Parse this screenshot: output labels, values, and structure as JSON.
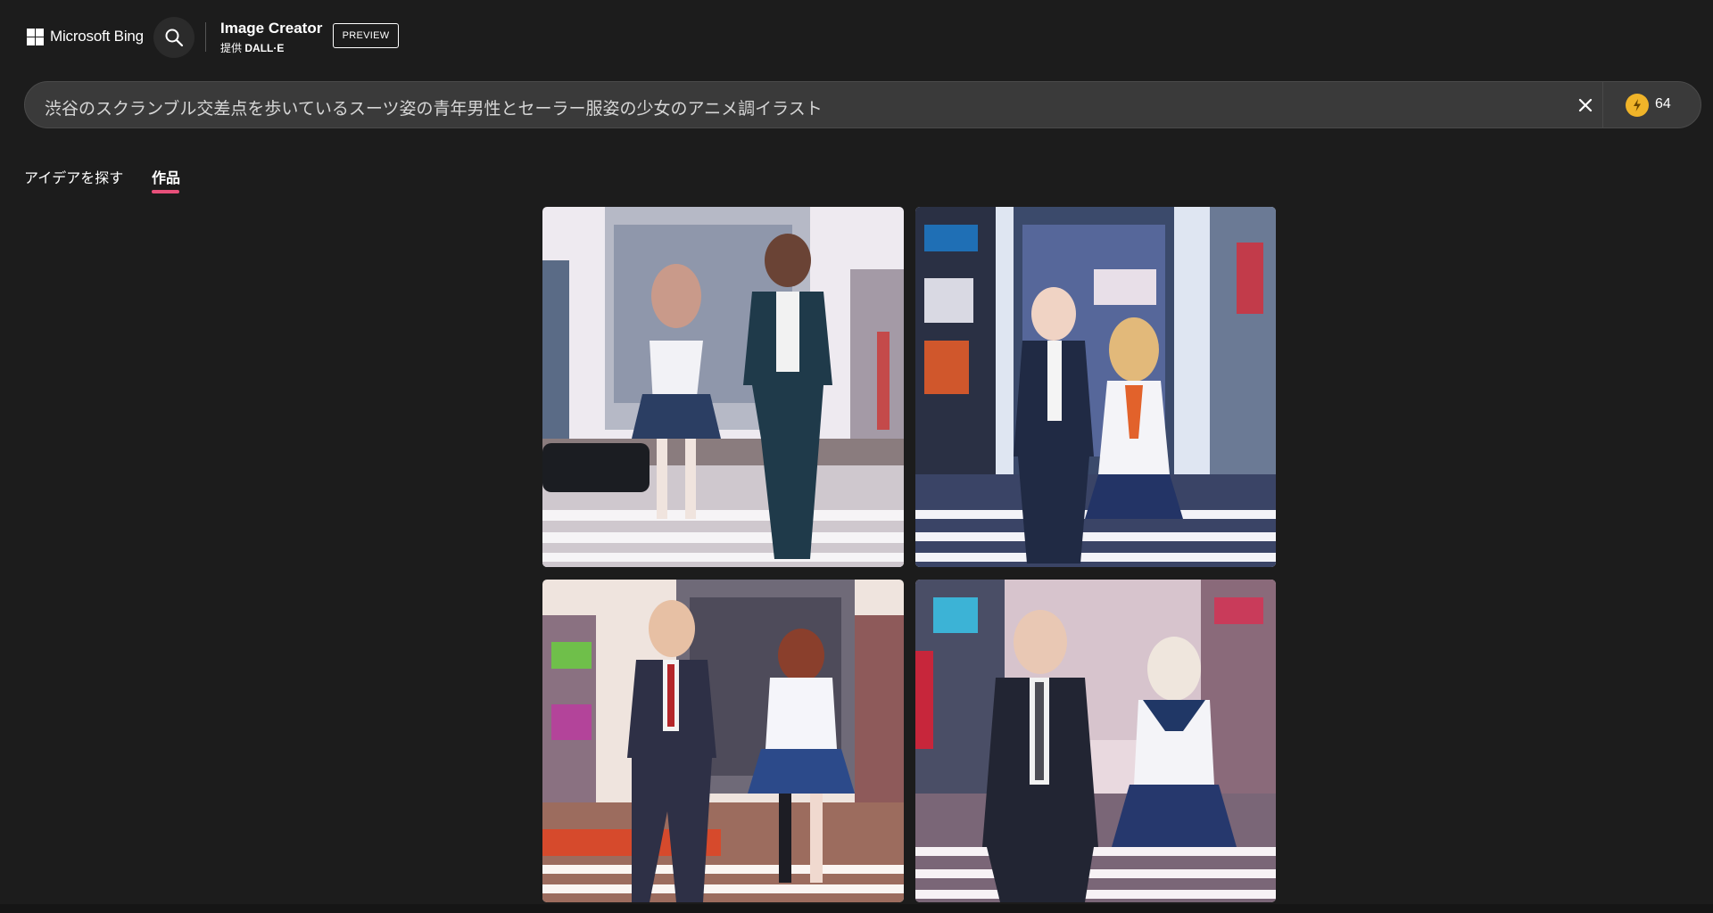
{
  "header": {
    "brand": "Microsoft Bing",
    "app_title": "Image Creator",
    "subtitle_prefix": "提供",
    "subtitle_model": "DALL·E",
    "preview_badge": "PREVIEW",
    "search_icon": "search-icon"
  },
  "prompt": {
    "value": "渋谷のスクランブル交差点を歩いているスーツ姿の青年男性とセーラー服姿の少女のアニメ調イラスト",
    "clear_icon": "close-icon",
    "boost_icon": "lightning-coin-icon",
    "boost_count": "64"
  },
  "tabs": [
    {
      "label": "アイデアを探す",
      "active": false
    },
    {
      "label": "作品",
      "active": true
    }
  ],
  "colors": {
    "background": "#1c1c1c",
    "prompt_bar": "#3a3a3a",
    "active_tab_underline": "#e8507a",
    "coin": "#f0b429"
  },
  "images": [
    {
      "depicts": "generated-image-1"
    },
    {
      "depicts": "generated-image-2"
    },
    {
      "depicts": "generated-image-3"
    },
    {
      "depicts": "generated-image-4"
    }
  ]
}
